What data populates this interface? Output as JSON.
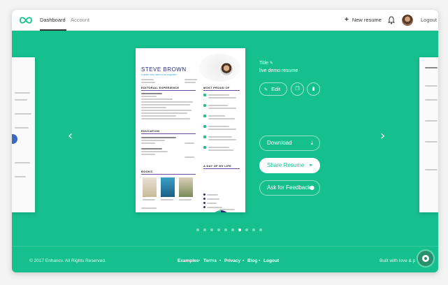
{
  "nav": {
    "dashboard": "Dashboard",
    "account": "Account",
    "new_resume": "New resume",
    "logout": "Logout"
  },
  "resume": {
    "name": "STEVE BROWN",
    "subtitle": "a writer who used to an engineer",
    "sections": {
      "experience": "EDITORIAL EXPERIENCE",
      "education": "EDUCATION",
      "books": "BOOKS",
      "proud": "MOST PROUD OF",
      "day": "A DAY OF MY LIFE"
    }
  },
  "details": {
    "title_label": "Title",
    "title_value": "live demo resume",
    "edit_label": "Edit",
    "download_label": "Download",
    "share_label": "Share Resume",
    "feedback_label": "Ask for Feedback"
  },
  "pager": {
    "count": 10,
    "active_index": 6
  },
  "footer": {
    "copyright": "© 2017 Enhancv. All Rights Reserved.",
    "links": [
      "Examples",
      "Terms",
      "Privacy",
      "Blog",
      "Logout"
    ],
    "built_with": "Built with love & p"
  },
  "colors": {
    "accent": "#16bf8e",
    "resume_title": "#2a2d7a"
  },
  "icons": [
    "infinity-logo-icon",
    "plus-icon",
    "bell-icon",
    "pencil-icon",
    "copy-icon",
    "trash-icon",
    "download-icon",
    "link-icon",
    "chat-icon",
    "chevron-left-icon",
    "chevron-right-icon",
    "help-icon"
  ]
}
